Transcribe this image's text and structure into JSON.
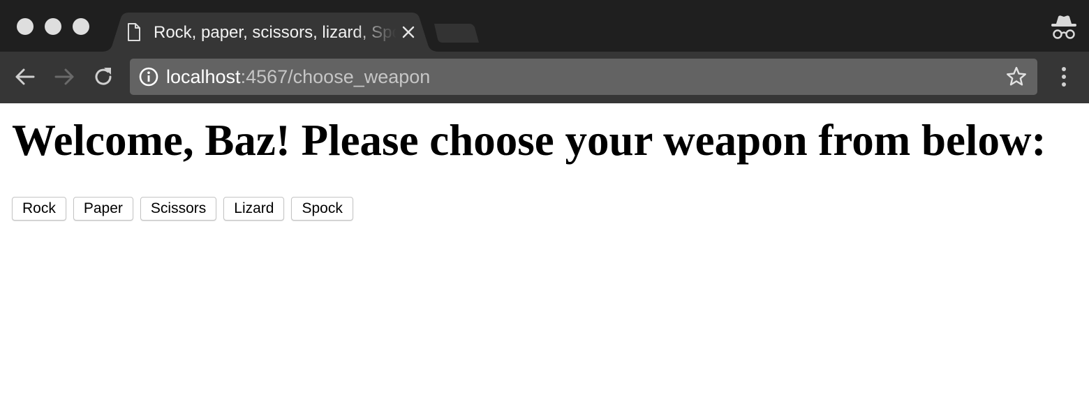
{
  "browser": {
    "tab": {
      "title": "Rock, paper, scissors, lizard, Spock",
      "favicon": "page-icon",
      "close_icon": "close-icon"
    },
    "new_tab_icon": "new-tab-icon",
    "incognito_icon": "incognito-icon",
    "toolbar": {
      "back_icon": "back-arrow-icon",
      "forward_icon": "forward-arrow-icon",
      "reload_icon": "reload-icon",
      "info_icon": "info-icon",
      "url_host": "localhost",
      "url_rest": ":4567/choose_weapon",
      "bookmark_icon": "star-icon",
      "menu_icon": "kebab-menu-icon"
    },
    "colors": {
      "tabstrip_bg": "#1f1f1f",
      "active_tab_bg": "#363636",
      "toolbar_bg": "#363636",
      "omnibox_bg": "#636363",
      "traffic_lights": "#dedede"
    }
  },
  "page": {
    "heading": "Welcome, Baz! Please choose your weapon from below:",
    "weapons": [
      {
        "label": "Rock"
      },
      {
        "label": "Paper"
      },
      {
        "label": "Scissors"
      },
      {
        "label": "Lizard"
      },
      {
        "label": "Spock"
      }
    ]
  }
}
